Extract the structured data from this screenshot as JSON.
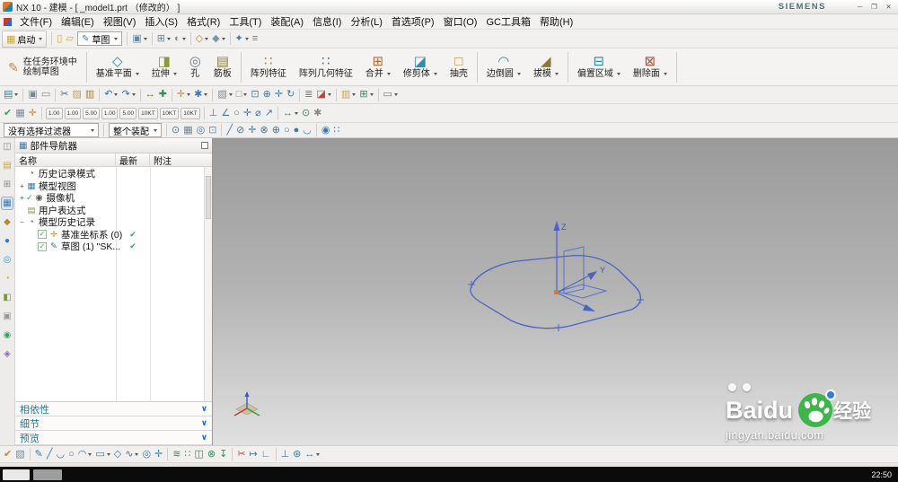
{
  "title_bar": {
    "title": "NX 10 - 建模 - [ _model1.prt （修改的） ]",
    "brand": "SIEMENS",
    "window_buttons": [
      {
        "name": "minimize-button",
        "glyph": "─"
      },
      {
        "name": "restore-button",
        "glyph": "❐"
      },
      {
        "name": "close-button",
        "glyph": "✕"
      }
    ]
  },
  "menu_bar": {
    "items": [
      {
        "label": "文件(F)",
        "name": "file"
      },
      {
        "label": "编辑(E)",
        "name": "edit"
      },
      {
        "label": "视图(V)",
        "name": "view"
      },
      {
        "label": "插入(S)",
        "name": "insert"
      },
      {
        "label": "格式(R)",
        "name": "format"
      },
      {
        "label": "工具(T)",
        "name": "tools"
      },
      {
        "label": "装配(A)",
        "name": "assemblies"
      },
      {
        "label": "信息(I)",
        "name": "information"
      },
      {
        "label": "分析(L)",
        "name": "analysis"
      },
      {
        "label": "首选项(P)",
        "name": "preferences"
      },
      {
        "label": "窗口(O)",
        "name": "window"
      },
      {
        "label": "GC工具箱",
        "name": "gc-toolbox"
      },
      {
        "label": "帮助(H)",
        "name": "help"
      }
    ]
  },
  "toolbar_top": {
    "start_button": {
      "label": "启动",
      "glyph": "▦",
      "color": "#caa53a"
    },
    "left_icons": [
      {
        "n": "new-file",
        "g": "▯",
        "c": "#caa53a"
      },
      {
        "n": "open-file",
        "g": "▱",
        "c": "#d8a73a"
      }
    ],
    "sketch_combo": {
      "value": "草图",
      "glyph": "✎",
      "color": "#3a7ab0"
    },
    "right_icons": [
      {
        "n": "display-part",
        "g": "▣",
        "c": "#6a8aa0",
        "dd": true
      },
      "|",
      {
        "n": "window-layout",
        "g": "⊞",
        "c": "#6a8aa0",
        "dd": true
      },
      {
        "n": "show-hide",
        "g": "◐",
        "c": "#888888",
        "dd": true
      },
      "|",
      {
        "n": "orient-view",
        "g": "◇",
        "c": "#b08a3a",
        "dd": true
      },
      {
        "n": "rendering-style",
        "g": "◆",
        "c": "#7a9ab0",
        "dd": true
      },
      "|",
      {
        "n": "snap-view",
        "g": "✦",
        "c": "#3a7ab0",
        "dd": true
      },
      {
        "n": "work-layer",
        "g": "≡",
        "c": "#777777"
      }
    ]
  },
  "ribbon": {
    "buttons": [
      {
        "icon": "sketch-in-task",
        "glyph": "✎",
        "color": "#c8872a",
        "line1": "在任务环境中",
        "line2": "绘制草图"
      },
      "|",
      {
        "icon": "datum-plane",
        "glyph": "◇",
        "color": "#2e8b9a",
        "label": "基准平面",
        "dd": true
      },
      {
        "icon": "extrude",
        "glyph": "◨",
        "color": "#8a9a3a",
        "label": "拉伸",
        "dd": true
      },
      {
        "icon": "hole",
        "glyph": "◎",
        "color": "#6a7a8a",
        "label": "孔"
      },
      {
        "icon": "rib",
        "glyph": "▤",
        "color": "#8a7a4a",
        "label": "筋板"
      },
      "|",
      {
        "icon": "pattern-feature",
        "glyph": "∷",
        "color": "#b0893a",
        "label": "阵列特征"
      },
      {
        "icon": "pattern-geometry",
        "glyph": "∷",
        "color": "#3a7ab0",
        "label": "阵列几何特征"
      },
      {
        "icon": "unite",
        "glyph": "⊞",
        "color": "#b06a3a",
        "label": "合并",
        "dd": true
      },
      {
        "icon": "trim-body",
        "glyph": "◪",
        "color": "#3a8ab0",
        "label": "修剪体",
        "dd": true
      },
      {
        "icon": "shell",
        "glyph": "□",
        "color": "#b0893a",
        "label": "抽壳"
      },
      "|",
      {
        "icon": "edge-blend",
        "glyph": "◠",
        "color": "#3a8ab0",
        "label": "边倒圆",
        "dd": true
      },
      {
        "icon": "draft",
        "glyph": "◢",
        "color": "#8a7a3a",
        "label": "拔模",
        "dd": true
      },
      "|",
      {
        "icon": "offset-region",
        "glyph": "⊟",
        "color": "#2e8b9a",
        "label": "偏置区域",
        "dd": true
      },
      {
        "icon": "delete-face",
        "glyph": "⊠",
        "color": "#b04a3a",
        "label": "删除面",
        "dd": true
      },
      "|"
    ]
  },
  "toolbar_mid": {
    "icons": [
      {
        "n": "menu-button",
        "g": "▤",
        "c": "#2e8b9a",
        "dd": true
      },
      "|",
      {
        "n": "touch-mode",
        "g": "▣",
        "c": "#778899"
      },
      {
        "n": "full-screen",
        "g": "▭",
        "c": "#778899"
      },
      "|",
      {
        "n": "cut",
        "g": "✂",
        "c": "#4a6a8a"
      },
      {
        "n": "copy",
        "g": "▨",
        "c": "#caa53a"
      },
      {
        "n": "paste",
        "g": "▥",
        "c": "#b07a3a"
      },
      "|",
      {
        "n": "undo",
        "g": "↶",
        "c": "#2a6ad0",
        "dd": true
      },
      {
        "n": "redo",
        "g": "↷",
        "c": "#2a6ad0",
        "dd": true
      },
      "|",
      {
        "n": "measure-distance",
        "g": "↔",
        "c": "#8a6a3a"
      },
      {
        "n": "move-object",
        "g": "✚",
        "c": "#3a8a5a"
      },
      "|",
      {
        "n": "datum-csys",
        "g": "✛",
        "c": "#c8872a",
        "dd": true
      },
      {
        "n": "point",
        "g": "✱",
        "c": "#3a7ab0",
        "dd": true
      },
      "|",
      {
        "n": "shaded-with-edges",
        "g": "▧",
        "c": "#7a8a9a",
        "dd": true
      },
      {
        "n": "wireframe",
        "g": "□",
        "c": "#7a8a9a",
        "dd": true
      },
      {
        "n": "fit-view",
        "g": "⊡",
        "c": "#3a7ab0"
      },
      {
        "n": "zoom",
        "g": "⊕",
        "c": "#3a7ab0"
      },
      {
        "n": "pan",
        "g": "✛",
        "c": "#3a7ab0"
      },
      {
        "n": "rotate-view",
        "g": "↻",
        "c": "#3a7ab0"
      },
      "|",
      {
        "n": "layer-settings",
        "g": "≣",
        "c": "#777777"
      },
      {
        "n": "view-section",
        "g": "◪",
        "c": "#b04a3a",
        "dd": true
      },
      "|",
      {
        "n": "assembly-constraints",
        "g": "▥",
        "c": "#caa53a",
        "dd": true
      },
      {
        "n": "wave-geometry-linker",
        "g": "⊞",
        "c": "#3a8a5a",
        "dd": true
      },
      "|",
      {
        "n": "window-switch",
        "g": "▭",
        "c": "#777777",
        "dd": true
      }
    ]
  },
  "toolbar_snap": {
    "left_icons": [
      {
        "n": "snap-enable",
        "g": "✔",
        "c": "#2fa848"
      },
      {
        "n": "grid-display",
        "g": "▦",
        "c": "#7a8a9a"
      },
      {
        "n": "sketch-csys",
        "g": "✛",
        "c": "#c8872a"
      },
      "|"
    ],
    "chips": [
      "1.00",
      "1.00",
      "5.00",
      "1.00",
      "5.00",
      "10KT",
      "10KT",
      "10KT"
    ],
    "right_icons": [
      "|",
      {
        "n": "perpendicular-snap",
        "g": "⊥",
        "c": "#3a7ab0"
      },
      {
        "n": "angle-snap",
        "g": "∠",
        "c": "#3a7ab0"
      },
      {
        "n": "circle-snap",
        "g": "○",
        "c": "#3a7ab0"
      },
      {
        "n": "point-snap",
        "g": "✛",
        "c": "#3a7ab0"
      },
      {
        "n": "diameter-snap",
        "g": "⌀",
        "c": "#3a7ab0"
      },
      {
        "n": "vector-snap",
        "g": "↗",
        "c": "#3a7ab0"
      },
      "|",
      {
        "n": "dimension-tool",
        "g": "↔",
        "c": "#3a8a5a",
        "dd": true
      },
      {
        "n": "constraint-tool",
        "g": "⊙",
        "c": "#3a8a5a"
      },
      {
        "n": "display-constraints",
        "g": "✱",
        "c": "#888888"
      }
    ]
  },
  "filter_bar": {
    "selection_filter": "没有选择过滤器",
    "selection_scope": "整个装配",
    "icons": [
      "|",
      {
        "n": "highlight-selection",
        "g": "⊙",
        "c": "#3a7ab0"
      },
      {
        "n": "select-all",
        "g": "▦",
        "c": "#6a8aa0"
      },
      {
        "n": "general-selection",
        "g": "◎",
        "c": "#3a7ab0"
      },
      {
        "n": "region-select",
        "g": "⊡",
        "c": "#6a8aa0"
      },
      "|",
      {
        "n": "snap-end-point",
        "g": "╱",
        "c": "#3a7ab0"
      },
      {
        "n": "snap-mid-point",
        "g": "⊘",
        "c": "#3a7ab0"
      },
      {
        "n": "snap-control-point",
        "g": "✛",
        "c": "#3a7ab0"
      },
      {
        "n": "snap-intersection",
        "g": "⊗",
        "c": "#3a7ab0"
      },
      {
        "n": "snap-arc-center",
        "g": "⊕",
        "c": "#3a7ab0"
      },
      {
        "n": "snap-quadrant",
        "g": "○",
        "c": "#3a7ab0"
      },
      {
        "n": "snap-existing-point",
        "g": "●",
        "c": "#3a7ab0"
      },
      {
        "n": "snap-point-on-curve",
        "g": "◡",
        "c": "#3a7ab0"
      },
      "|",
      {
        "n": "snap-point-on-face",
        "g": "◉",
        "c": "#3a7ab0"
      },
      {
        "n": "snap-bounded-grid",
        "g": "∷",
        "c": "#3a7ab0"
      }
    ]
  },
  "left_strip": {
    "icons": [
      {
        "n": "resource-bar-pin",
        "g": "◫",
        "c": "#888888"
      },
      {
        "n": "assembly-navigator",
        "g": "▤",
        "c": "#caa53a"
      },
      {
        "n": "constraint-navigator",
        "g": "⊞",
        "c": "#888888"
      },
      {
        "n": "part-navigator",
        "g": "▦",
        "c": "#3a7ab0",
        "active": true
      },
      {
        "n": "reuse-library",
        "g": "◆",
        "c": "#b08a3a"
      },
      {
        "n": "hd3d-tools",
        "g": "●",
        "c": "#2a7ad0"
      },
      {
        "n": "web-browser",
        "g": "◎",
        "c": "#3a9ad0"
      },
      {
        "n": "history",
        "g": "◔",
        "c": "#caa53a"
      },
      {
        "n": "process-studio",
        "g": "◧",
        "c": "#7a9a3a"
      },
      {
        "n": "manage",
        "g": "▣",
        "c": "#999999"
      },
      {
        "n": "roles",
        "g": "◉",
        "c": "#3aa06a"
      },
      {
        "n": "system-materials",
        "g": "◈",
        "c": "#8a6ab0"
      }
    ]
  },
  "navigator": {
    "title": "部件导航器",
    "columns": [
      "名称",
      "最新",
      "附注"
    ],
    "rows": [
      {
        "name": "history-mode",
        "label": "历史记录模式",
        "icon_glyph": "◔",
        "icon_color": "#c43b2a",
        "indent": 0
      },
      {
        "name": "model-views",
        "label": "模型视图",
        "expander": "+",
        "icon_glyph": "▦",
        "icon_color": "#3a7ab0",
        "indent": 0
      },
      {
        "name": "cameras",
        "label": "摄像机",
        "expander": "+",
        "pre_check": true,
        "icon_glyph": "◉",
        "icon_color": "#555555",
        "indent": 0
      },
      {
        "name": "user-expressions",
        "label": "用户表达式",
        "icon_glyph": "▤",
        "icon_color": "#8a9a3a",
        "indent": 0
      },
      {
        "name": "model-history",
        "label": "模型历史记录",
        "expander": "−",
        "icon_glyph": "◔",
        "icon_color": "#3a8a5a",
        "indent": 0
      },
      {
        "name": "datum-csys",
        "label": "基准坐标系 (0)",
        "checkbox": true,
        "icon_glyph": "✛",
        "icon_color": "#c8872a",
        "status": "✔",
        "indent": 1
      },
      {
        "name": "sketch-1",
        "label": "草图 (1) \"SK...",
        "checkbox": true,
        "icon_glyph": "✎",
        "icon_color": "#3a7ab0",
        "status": "✔",
        "indent": 1
      }
    ],
    "sections": [
      {
        "name": "dependencies",
        "label": "相依性",
        "chevron": "∨"
      },
      {
        "name": "details",
        "label": "细节",
        "chevron": "∨"
      },
      {
        "name": "preview",
        "label": "预览",
        "chevron": "∨"
      }
    ]
  },
  "viewport": {
    "axes": {
      "z": "Z",
      "y": "Y"
    },
    "watermark": {
      "brand": "Baidu",
      "cn": "经验",
      "url": "jingyan.baidu.com"
    }
  },
  "bottom_toolbar": {
    "icons": [
      {
        "n": "finish-sketch",
        "g": "✔",
        "c": "#c8872a"
      },
      {
        "n": "sketch-style",
        "g": "▧",
        "c": "#7a8a9a"
      },
      "|",
      {
        "n": "profile",
        "g": "✎",
        "c": "#3a7ab0"
      },
      {
        "n": "line",
        "g": "╱",
        "c": "#3a7ab0"
      },
      {
        "n": "arc",
        "g": "◡",
        "c": "#3a7ab0"
      },
      {
        "n": "circle",
        "g": "○",
        "c": "#3a7ab0"
      },
      {
        "n": "fillet",
        "g": "◠",
        "c": "#3a7ab0",
        "dd": true
      },
      {
        "n": "rectangle",
        "g": "▭",
        "c": "#3a7ab0",
        "dd": true
      },
      {
        "n": "polygon",
        "g": "◇",
        "c": "#3a7ab0"
      },
      {
        "n": "studio-spline",
        "g": "∿",
        "c": "#3a7ab0",
        "dd": true
      },
      {
        "n": "ellipse",
        "g": "◎",
        "c": "#3a7ab0"
      },
      {
        "n": "point",
        "g": "✛",
        "c": "#3a7ab0"
      },
      "|",
      {
        "n": "offset-curve",
        "g": "≋",
        "c": "#3a8a5a"
      },
      {
        "n": "pattern-curve",
        "g": "∷",
        "c": "#3a8a5a"
      },
      {
        "n": "mirror-curve",
        "g": "◫",
        "c": "#3a8a5a"
      },
      {
        "n": "intersection-point",
        "g": "⊗",
        "c": "#3a8a5a"
      },
      {
        "n": "project-curve",
        "g": "↧",
        "c": "#3a8a5a"
      },
      "|",
      {
        "n": "quick-trim",
        "g": "✂",
        "c": "#b04a3a"
      },
      {
        "n": "quick-extend",
        "g": "↦",
        "c": "#3a7ab0"
      },
      {
        "n": "make-corner",
        "g": "∟",
        "c": "#3a7ab0"
      },
      "|",
      {
        "n": "geometric-constraints",
        "g": "⊥",
        "c": "#3a7ab0"
      },
      {
        "n": "auto-constrain",
        "g": "⊛",
        "c": "#3a7ab0"
      },
      {
        "n": "rapid-dimension",
        "g": "↔",
        "c": "#3a7ab0",
        "dd": true
      }
    ]
  },
  "taskbar": {
    "time": "22:50"
  }
}
